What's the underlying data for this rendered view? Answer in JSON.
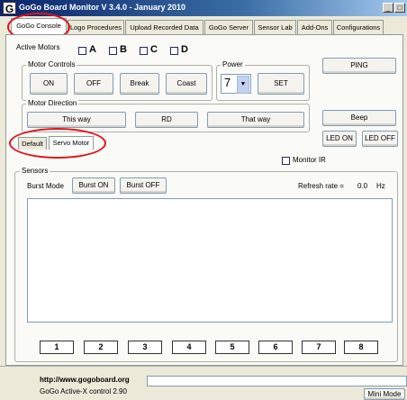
{
  "window": {
    "title": "GoGo Board Monitor V 3.4.0 - January 2010",
    "logo": "G",
    "min_glyph": "_",
    "max_glyph": "□",
    "close_glyph": "x"
  },
  "tabs": [
    {
      "label": "GoGo Console",
      "active": true
    },
    {
      "label": "Logo Procedures",
      "active": false
    },
    {
      "label": "Upload Recorded Data",
      "active": false
    },
    {
      "label": "GoGo Server",
      "active": false
    },
    {
      "label": "Sensor Lab",
      "active": false
    },
    {
      "label": "Add-Ons",
      "active": false
    },
    {
      "label": "Configurations",
      "active": false
    }
  ],
  "active_motors": {
    "label": "Active Motors",
    "motors": [
      {
        "letter": "A",
        "checked": false
      },
      {
        "letter": "B",
        "checked": false
      },
      {
        "letter": "C",
        "checked": false
      },
      {
        "letter": "D",
        "checked": false
      }
    ]
  },
  "motor_controls": {
    "title": "Motor Controls",
    "buttons": [
      "ON",
      "OFF",
      "Break",
      "Coast"
    ]
  },
  "power": {
    "title": "Power",
    "value": "7",
    "set_label": "SET"
  },
  "motor_direction": {
    "title": "Motor Direction",
    "this_way": "This way",
    "rd": "RD",
    "that_way": "That way"
  },
  "right_buttons": {
    "ping": "PING",
    "beep": "Beep",
    "led_on": "LED ON",
    "led_off": "LED OFF"
  },
  "mode_tabs": {
    "default": "Default",
    "servo": "Servo Motor"
  },
  "monitor_ir": {
    "label": "Monitor IR",
    "checked": false
  },
  "sensors": {
    "title": "Sensors",
    "burst_mode_label": "Burst Mode",
    "burst_on": "Burst ON",
    "burst_off": "Burst OFF",
    "refresh_label": "Refresh rate =",
    "refresh_value": "0.0",
    "refresh_unit": "Hz",
    "channels": [
      "1",
      "2",
      "3",
      "4",
      "5",
      "6",
      "7",
      "8"
    ]
  },
  "status": {
    "url": "http://www.gogoboard.org",
    "activex": "GoGo Active-X control  2.90",
    "mini_mode": "Mini Mode"
  },
  "colors": {
    "highlight_ellipse": "#e0121a",
    "title_bar": "#0a246a"
  }
}
